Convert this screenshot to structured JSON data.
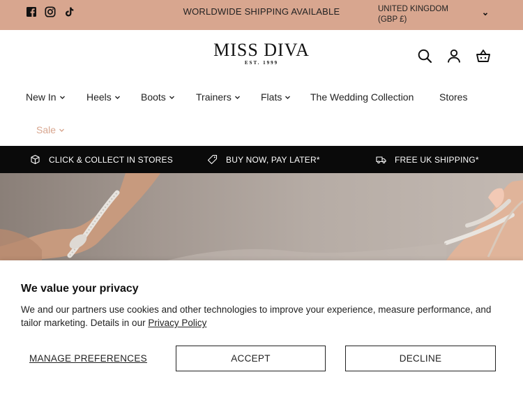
{
  "topbar": {
    "social_icons": [
      "facebook-icon",
      "instagram-icon",
      "tiktok-icon"
    ],
    "shipping_text": "WORLDWIDE SHIPPING AVAILABLE",
    "country_line1": "UNITED KINGDOM",
    "country_line2": "(GBP £)",
    "background": "#d8a68f"
  },
  "header": {
    "logo_main": "MISS DIVA",
    "logo_sub": "EST. 1999",
    "icons": [
      "search-icon",
      "account-icon",
      "basket-icon"
    ]
  },
  "nav": {
    "items": [
      {
        "label": "New In",
        "has_dropdown": true
      },
      {
        "label": "Heels",
        "has_dropdown": true
      },
      {
        "label": "Boots",
        "has_dropdown": true
      },
      {
        "label": "Trainers",
        "has_dropdown": true
      },
      {
        "label": "Flats",
        "has_dropdown": true
      },
      {
        "label": "The Wedding Collection",
        "has_dropdown": false
      },
      {
        "label": "Stores",
        "has_dropdown": false
      },
      {
        "label": "Sale",
        "has_dropdown": true
      }
    ],
    "sale_color": "#d8a68f"
  },
  "usp": {
    "items": [
      {
        "icon": "box-icon",
        "label": "CLICK & COLLECT IN STORES"
      },
      {
        "icon": "tag-icon",
        "label": "BUY NOW, PAY LATER*"
      },
      {
        "icon": "truck-icon",
        "label": "FREE UK SHIPPING*"
      }
    ]
  },
  "cookie": {
    "title": "We value your privacy",
    "text": "We and our partners use cookies and other technologies to improve your experience, measure performance, and tailor marketing. Details in our",
    "link": "Privacy Policy",
    "manage_label": "MANAGE PREFERENCES",
    "accept_label": "ACCEPT",
    "decline_label": "DECLINE"
  }
}
